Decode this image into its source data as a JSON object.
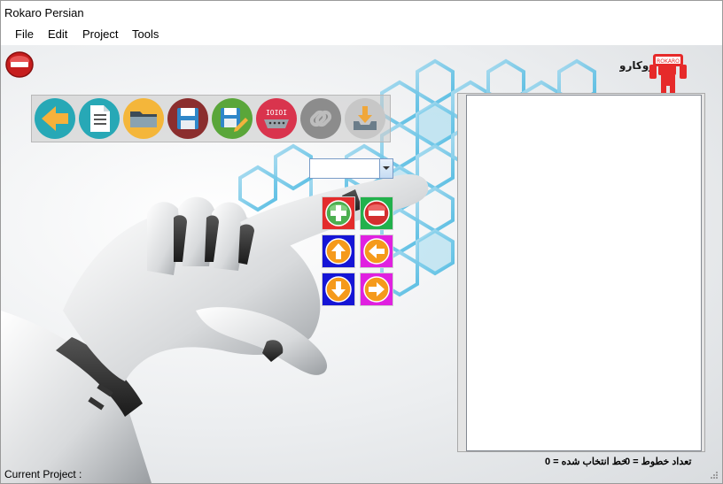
{
  "window": {
    "title": "Rokaro Persian"
  },
  "menu": {
    "items": [
      "File",
      "Edit",
      "Project",
      "Tools"
    ]
  },
  "toolbar": {
    "buttons": [
      {
        "name": "back-button",
        "icon": "arrow-left-icon",
        "color": "#27a8b6"
      },
      {
        "name": "new-button",
        "icon": "document-icon",
        "color": "#27a8b6"
      },
      {
        "name": "open-button",
        "icon": "folder-icon",
        "color": "#f4b63a"
      },
      {
        "name": "save-button",
        "icon": "floppy-disk-icon",
        "color": "#8b2e2e"
      },
      {
        "name": "save-as-button",
        "icon": "floppy-edit-icon",
        "color": "#5aa63a"
      },
      {
        "name": "serial-button",
        "icon": "serial-port-icon",
        "color": "#d9344d"
      },
      {
        "name": "link-button",
        "icon": "chain-link-icon",
        "color": "#8c8c8c"
      },
      {
        "name": "download-button",
        "icon": "download-tray-icon",
        "color": "#bdbdbd"
      }
    ]
  },
  "combo": {
    "value": ""
  },
  "controls": {
    "add": {
      "icon": "plus-icon",
      "bg": "#e32c2c"
    },
    "remove": {
      "icon": "minus-icon",
      "bg": "#22b14c"
    },
    "up": {
      "icon": "arrow-up-icon",
      "bg": "#1515d6"
    },
    "left": {
      "icon": "arrow-left-icon",
      "bg": "#e020e0"
    },
    "down": {
      "icon": "arrow-down-icon",
      "bg": "#1515d6"
    },
    "right": {
      "icon": "arrow-right-icon",
      "bg": "#e020e0"
    }
  },
  "logo": {
    "text": "ROKARO"
  },
  "status": {
    "line_count": "تعداد خطوط = 0",
    "selected_line": "خط انتخاب شده = 0",
    "current_project": "Current Project :"
  }
}
